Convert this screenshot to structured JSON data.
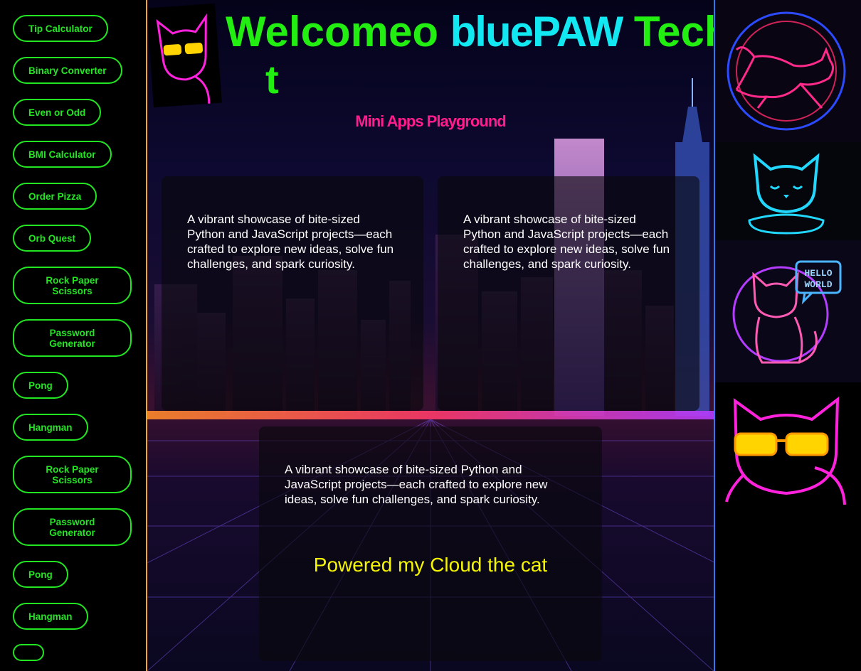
{
  "sidebar": {
    "items": [
      {
        "label": "Tip Calculator"
      },
      {
        "label": "Binary Converter"
      },
      {
        "label": "Even or Odd"
      },
      {
        "label": "BMI Calculator"
      },
      {
        "label": "Order Pizza"
      },
      {
        "label": "Orb Quest"
      },
      {
        "label": "Rock Paper Scissors"
      },
      {
        "label": "Password Generator"
      },
      {
        "label": "Pong"
      },
      {
        "label": "Hangman"
      },
      {
        "label": "Rock Paper Scissors"
      },
      {
        "label": "Password Generator"
      },
      {
        "label": "Pong"
      },
      {
        "label": "Hangman"
      },
      {
        "label": ""
      }
    ]
  },
  "header": {
    "title_part1": "Welcomeo",
    "title_brand": "bluePAW",
    "title_part2": "Tech",
    "title_wrap": "t",
    "subtitle": "Mini Apps Playground"
  },
  "cards": [
    {
      "text": "A vibrant showcase of bite-sized Python and JavaScript projects—each crafted to explore new ideas, solve fun challenges, and spark curiosity."
    },
    {
      "text": "A vibrant showcase of bite-sized Python and JavaScript projects—each crafted to explore new ideas, solve fun challenges, and spark curiosity."
    },
    {
      "text": "A vibrant showcase of bite-sized Python and JavaScript projects—each crafted to explore new ideas, solve fun challenges, and spark curiosity."
    }
  ],
  "footer": {
    "powered": "Powered my Cloud the cat"
  },
  "right_panel": {
    "speech_bubble": "HELLO WORLD"
  },
  "colors": {
    "accent_green": "#22e622",
    "brand_cyan": "#12e8f2",
    "subtitle_pink": "#ff1c8c",
    "powered_yellow": "#f6f600",
    "neon_magenta": "#ff22dd",
    "divider_orange": "#f5a623",
    "divider_blue": "#2c7bf0"
  }
}
